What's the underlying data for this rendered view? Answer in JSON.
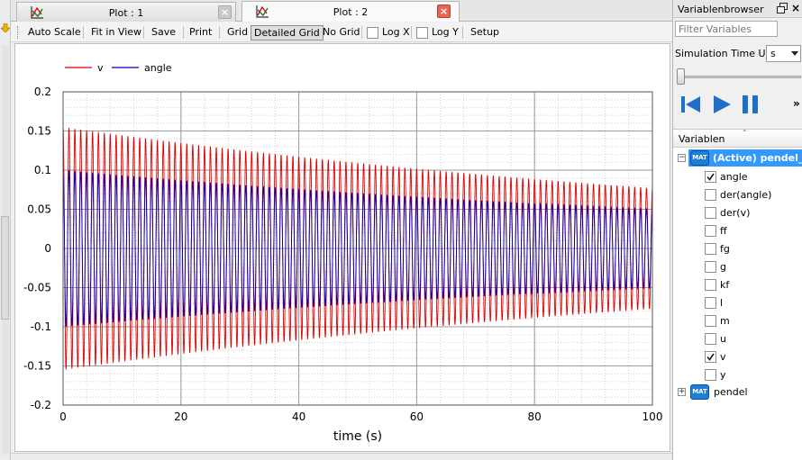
{
  "tabs": [
    {
      "label": "Plot : 1",
      "active": false
    },
    {
      "label": "Plot : 2",
      "active": true
    }
  ],
  "toolbar": {
    "auto_scale": "Auto Scale",
    "fit_in_view": "Fit in View",
    "save": "Save",
    "print": "Print",
    "grid": "Grid",
    "detailed_grid": "Detailed Grid",
    "no_grid": "No Grid",
    "log_x": "Log X",
    "log_y": "Log Y",
    "setup": "Setup"
  },
  "variables_browser": {
    "title": "Variablenbrowser",
    "filter_placeholder": "Filter Variables",
    "sim_time_unit_label": "Simulation Time Unit",
    "sim_time_unit_value": "s",
    "tree_header": "Variablen",
    "active_model": "(Active) pendel_Fl",
    "mat_badge": "MAT",
    "variables": [
      {
        "name": "angle",
        "checked": true
      },
      {
        "name": "der(angle)",
        "checked": false
      },
      {
        "name": "der(v)",
        "checked": false
      },
      {
        "name": "ff",
        "checked": false
      },
      {
        "name": "fg",
        "checked": false
      },
      {
        "name": "g",
        "checked": false
      },
      {
        "name": "kf",
        "checked": false
      },
      {
        "name": "l",
        "checked": false
      },
      {
        "name": "m",
        "checked": false
      },
      {
        "name": "u",
        "checked": false
      },
      {
        "name": "v",
        "checked": true
      },
      {
        "name": "y",
        "checked": false
      }
    ],
    "other_model": "pendel"
  },
  "chart_data": {
    "type": "line",
    "xlabel": "time (s)",
    "ylabel": "",
    "xlim": [
      0,
      100
    ],
    "ylim": [
      -0.2,
      0.2
    ],
    "x_ticks": [
      "0",
      "20",
      "40",
      "60",
      "80",
      "100"
    ],
    "y_ticks": [
      "0.2",
      "0.15",
      "0.1",
      "0.05",
      "0",
      "-0.05",
      "-0.1",
      "-0.15",
      "-0.2"
    ],
    "grid": "detailed",
    "legend_position": "top-left",
    "series": [
      {
        "name": "v",
        "color": "#dd0000",
        "amplitude_start": 0.155,
        "amplitude_end": 0.077,
        "period": 1.0
      },
      {
        "name": "angle",
        "color": "#0000bb",
        "amplitude_start": 0.1,
        "amplitude_end": 0.05,
        "period": 1.0
      }
    ]
  }
}
